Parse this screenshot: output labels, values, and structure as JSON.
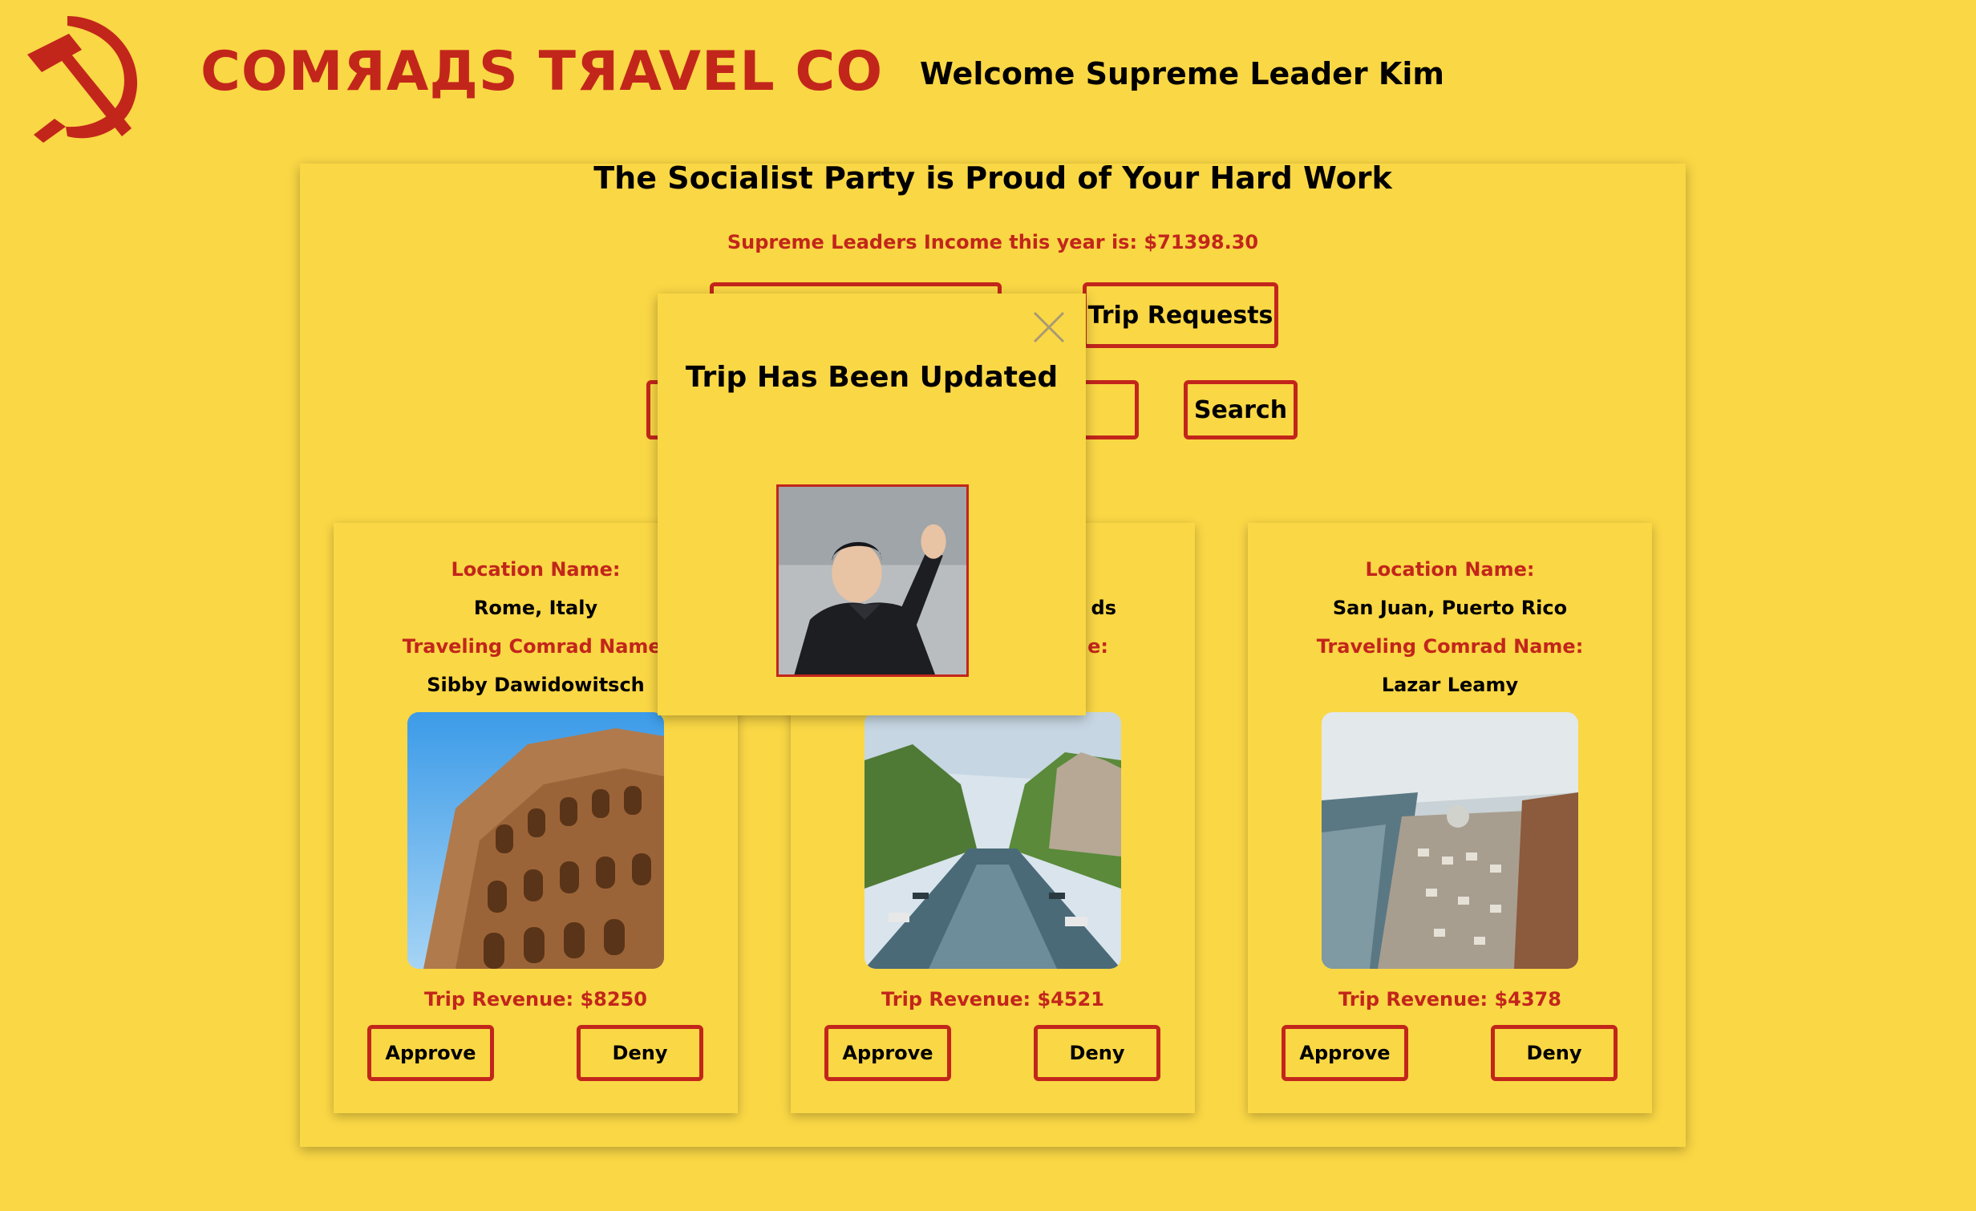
{
  "header": {
    "brand": "COMЯAДS TЯAVEL CO",
    "welcome": "Welcome Supreme Leader Kim",
    "logo_icon": "hammer-and-sickle-icon"
  },
  "panel": {
    "title": "The Socialist Party is Proud of Your Hard Work",
    "income": "Supreme Leaders Income this year is: $71398.30",
    "trip_requests_label": "Trip Requests",
    "search_label": "Search",
    "search_value": ""
  },
  "cards": [
    {
      "location_label": "Location Name:",
      "location": "Rome, Italy",
      "comrad_label": "Traveling Comrad Name:",
      "comrad": "Sibby Dawidowitsch",
      "revenue": "Trip Revenue: $8250",
      "approve_label": "Approve",
      "deny_label": "Deny"
    },
    {
      "location_label": "",
      "location": "ds",
      "comrad_label": "e:",
      "comrad": "",
      "revenue": "Trip Revenue: $4521",
      "approve_label": "Approve",
      "deny_label": "Deny"
    },
    {
      "location_label": "Location Name:",
      "location": "San Juan, Puerto Rico",
      "comrad_label": "Traveling Comrad Name:",
      "comrad": "Lazar Leamy",
      "revenue": "Trip Revenue: $4378",
      "approve_label": "Approve",
      "deny_label": "Deny"
    }
  ],
  "modal": {
    "title": "Trip Has Been Updated",
    "close_icon": "close-icon"
  },
  "colors": {
    "background": "#fad745",
    "accent": "#c2261b",
    "text": "#000000"
  }
}
